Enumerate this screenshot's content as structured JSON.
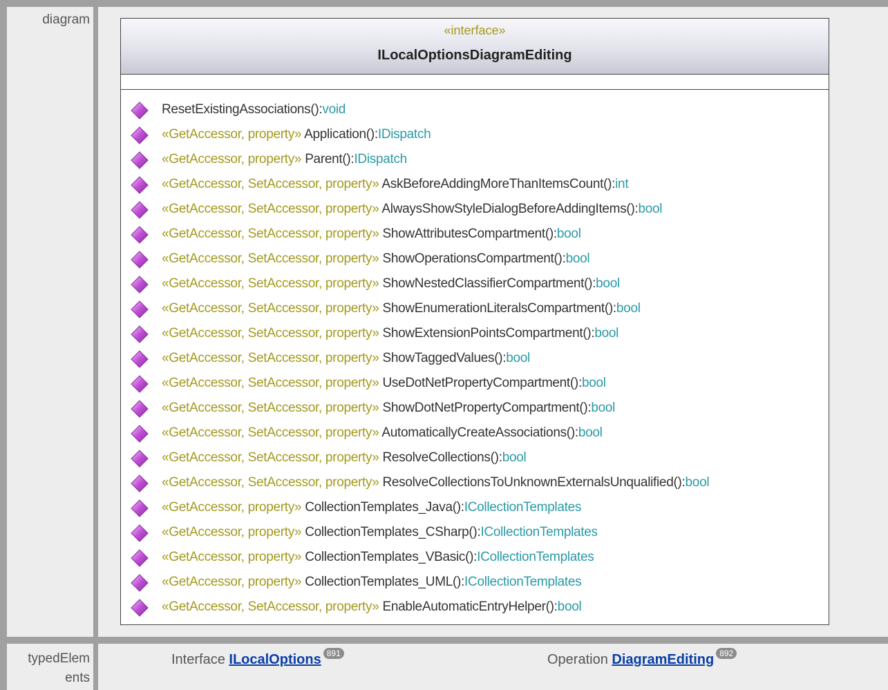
{
  "labels": {
    "diagram": "diagram",
    "typed_elements_line1": "typedElem",
    "typed_elements_line2": "ents"
  },
  "interface": {
    "stereotype": "«interface»",
    "name": "ILocalOptionsDiagramEditing"
  },
  "operations": [
    {
      "stereo": "",
      "name": "ResetExistingAssociations",
      "paren": "():",
      "type": "void"
    },
    {
      "stereo": "«GetAccessor, property» ",
      "name": "Application",
      "paren": "():",
      "type": "IDispatch"
    },
    {
      "stereo": "«GetAccessor, property» ",
      "name": "Parent",
      "paren": "():",
      "type": "IDispatch"
    },
    {
      "stereo": "«GetAccessor, SetAccessor, property» ",
      "name": "AskBeforeAddingMoreThanItemsCount",
      "paren": "():",
      "type": "int"
    },
    {
      "stereo": "«GetAccessor, SetAccessor, property» ",
      "name": "AlwaysShowStyleDialogBeforeAddingItems",
      "paren": "():",
      "type": "bool"
    },
    {
      "stereo": "«GetAccessor, SetAccessor, property» ",
      "name": "ShowAttributesCompartment",
      "paren": "():",
      "type": "bool"
    },
    {
      "stereo": "«GetAccessor, SetAccessor, property» ",
      "name": "ShowOperationsCompartment",
      "paren": "():",
      "type": "bool"
    },
    {
      "stereo": "«GetAccessor, SetAccessor, property» ",
      "name": "ShowNestedClassifierCompartment",
      "paren": "():",
      "type": "bool"
    },
    {
      "stereo": "«GetAccessor, SetAccessor, property» ",
      "name": "ShowEnumerationLiteralsCompartment",
      "paren": "():",
      "type": "bool"
    },
    {
      "stereo": "«GetAccessor, SetAccessor, property» ",
      "name": "ShowExtensionPointsCompartment",
      "paren": "():",
      "type": "bool"
    },
    {
      "stereo": "«GetAccessor, SetAccessor, property» ",
      "name": "ShowTaggedValues",
      "paren": "():",
      "type": "bool"
    },
    {
      "stereo": "«GetAccessor, SetAccessor, property» ",
      "name": "UseDotNetPropertyCompartment",
      "paren": "():",
      "type": "bool"
    },
    {
      "stereo": "«GetAccessor, SetAccessor, property» ",
      "name": "ShowDotNetPropertyCompartment",
      "paren": "():",
      "type": "bool"
    },
    {
      "stereo": "«GetAccessor, SetAccessor, property» ",
      "name": "AutomaticallyCreateAssociations",
      "paren": "():",
      "type": "bool"
    },
    {
      "stereo": "«GetAccessor, SetAccessor, property» ",
      "name": "ResolveCollections",
      "paren": "():",
      "type": "bool"
    },
    {
      "stereo": "«GetAccessor, SetAccessor, property» ",
      "name": "ResolveCollectionsToUnknownExternalsUnqualified",
      "paren": "():",
      "type": "bool"
    },
    {
      "stereo": "«GetAccessor, property» ",
      "name": "CollectionTemplates_Java",
      "paren": "():",
      "type": "ICollectionTemplates"
    },
    {
      "stereo": "«GetAccessor, property» ",
      "name": "CollectionTemplates_CSharp",
      "paren": "():",
      "type": "ICollectionTemplates"
    },
    {
      "stereo": "«GetAccessor, property» ",
      "name": "CollectionTemplates_VBasic",
      "paren": "():",
      "type": "ICollectionTemplates"
    },
    {
      "stereo": "«GetAccessor, property» ",
      "name": "CollectionTemplates_UML",
      "paren": "():",
      "type": "ICollectionTemplates"
    },
    {
      "stereo": "«GetAccessor, SetAccessor, property» ",
      "name": "EnableAutomaticEntryHelper",
      "paren": "():",
      "type": "bool"
    }
  ],
  "typed_elements": [
    {
      "kind": "Interface ",
      "link": "ILocalOptions",
      "badge": "891"
    },
    {
      "kind": "Operation ",
      "link": "DiagramEditing",
      "badge": "892"
    }
  ],
  "colors": {
    "stereotype": "#a39a1e",
    "type": "#2a9aa6",
    "link": "#0a3ea8",
    "icon": "#c04fd6"
  }
}
